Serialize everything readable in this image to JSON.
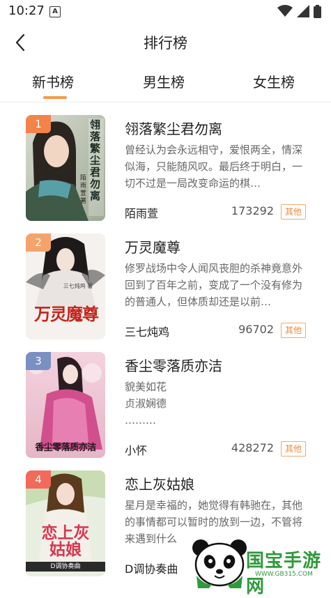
{
  "status_bar": {
    "time": "10:27",
    "notification_letter": "A"
  },
  "header": {
    "title": "排行榜"
  },
  "tabs": [
    {
      "label": "新书榜",
      "active": true
    },
    {
      "label": "男生榜",
      "active": false
    },
    {
      "label": "女生榜",
      "active": false
    }
  ],
  "books": [
    {
      "rank": "1",
      "rank_color": "#f4834a",
      "title": "翎落繁尘君勿离",
      "description": "曾经认为会永远相守，爱恨两全，情深似海，只能随风叹。最后终于明白，一切不过是一局改变命运的棋…",
      "author": "陌雨萱",
      "count": "173292",
      "tag": "其他",
      "cover_text": "翎落繁尘君勿离",
      "cover_author": "陌雨萱 著"
    },
    {
      "rank": "2",
      "rank_color": "#f6a36b",
      "title": "万灵魔尊",
      "description": "修罗战场中令人闻风丧胆的杀神竟意外回到了百年之前，变成了一个没有修为的普通人，但体质却还是以前…",
      "author": "三七炖鸡",
      "count": "96702",
      "tag": "其他",
      "cover_text": "万灵魔尊",
      "cover_author": "三七炖鸡 著"
    },
    {
      "rank": "3",
      "rank_color": "#7a8fc2",
      "title": "香尘零落质亦洁",
      "description_lines": [
        "貌美如花",
        "贞淑娴德",
        "………"
      ],
      "author": "小怀",
      "count": "428272",
      "tag": "其他",
      "cover_text": "香尘零落质亦洁"
    },
    {
      "rank": "4",
      "rank_color": "#f26a5a",
      "title": "恋上灰姑娘",
      "description": "星月是幸福的，她觉得有韩驰在，其他的事情都可以暂时的放到一边，不管将来遇到什么",
      "author": "D调协奏曲",
      "cover_text": "恋上灰姑娘",
      "cover_author": "D调协奏曲"
    }
  ],
  "watermark": {
    "main": "国宝手游网",
    "sub": "WWW.GB315.COM"
  },
  "colors": {
    "accent": "#f39a4c",
    "tag_border": "#f3a86a",
    "tag_text": "#f08a3c"
  }
}
